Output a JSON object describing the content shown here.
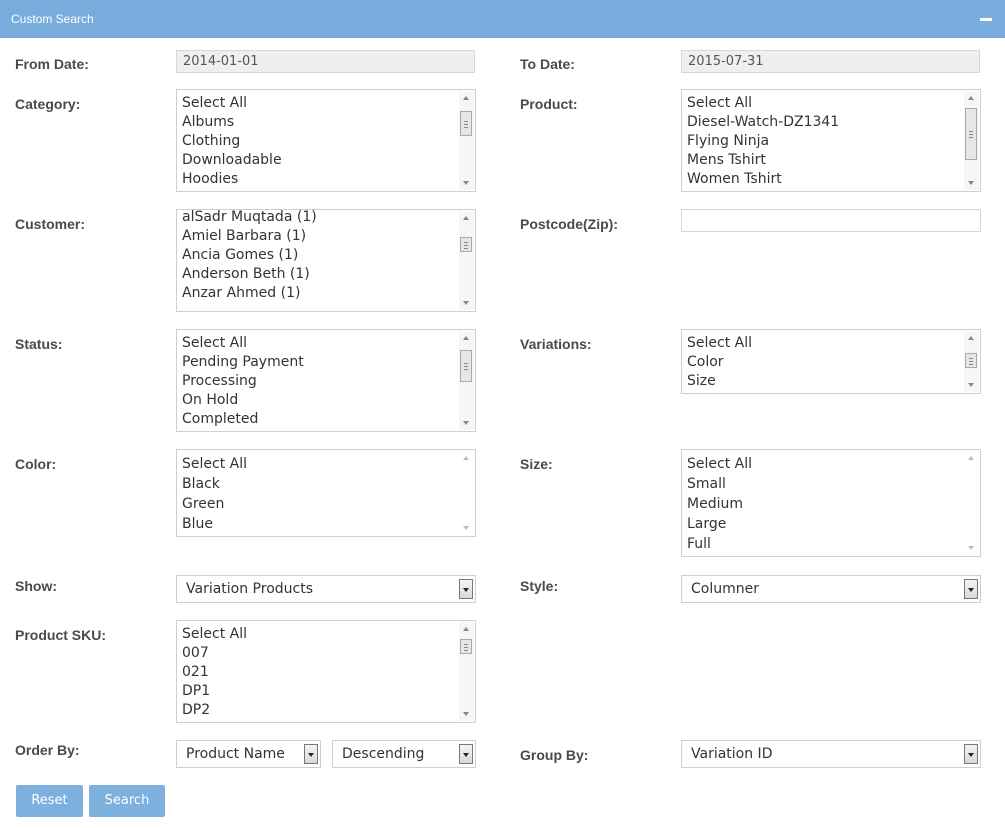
{
  "header": {
    "title": "Custom Search"
  },
  "fields": {
    "from_date": {
      "label": "From Date:",
      "value": "2014-01-01"
    },
    "to_date": {
      "label": "To Date:",
      "value": "2015-07-31"
    },
    "category": {
      "label": "Category:",
      "options": [
        "Select All",
        "Albums",
        "Clothing",
        "Downloadable",
        "Hoodies"
      ]
    },
    "product": {
      "label": "Product:",
      "options": [
        "Select All",
        "Diesel-Watch-DZ1341",
        "Flying Ninja",
        "Mens Tshirt",
        "Women Tshirt"
      ]
    },
    "customer": {
      "label": "Customer:",
      "options": [
        "alSadr Muqtada (1)",
        "Amiel Barbara (1)",
        "Ancia Gomes (1)",
        "Anderson Beth (1)",
        "Anzar Ahmed (1)"
      ]
    },
    "postcode": {
      "label": "Postcode(Zip):",
      "value": ""
    },
    "status": {
      "label": "Status:",
      "options": [
        "Select All",
        "Pending Payment",
        "Processing",
        "On Hold",
        "Completed"
      ]
    },
    "variations": {
      "label": "Variations:",
      "options": [
        "Select All",
        "Color",
        "Size"
      ]
    },
    "color": {
      "label": "Color:",
      "options": [
        "Select All",
        "Black",
        "Green",
        "Blue"
      ]
    },
    "size": {
      "label": "Size:",
      "options": [
        "Select All",
        "Small",
        "Medium",
        "Large",
        "Full"
      ]
    },
    "show": {
      "label": "Show:",
      "value": "Variation Products"
    },
    "style": {
      "label": "Style:",
      "value": "Columner"
    },
    "product_sku": {
      "label": "Product SKU:",
      "options": [
        "Select All",
        "007",
        "021",
        "DP1",
        "DP2"
      ]
    },
    "order_by": {
      "label": "Order By:",
      "field_value": "Product Name",
      "direction_value": "Descending"
    },
    "group_by": {
      "label": "Group By:",
      "value": "Variation ID"
    }
  },
  "buttons": {
    "reset": "Reset",
    "search": "Search"
  },
  "colors": {
    "header_bg": "#78acdc",
    "button_bg": "#7eb0dd"
  }
}
